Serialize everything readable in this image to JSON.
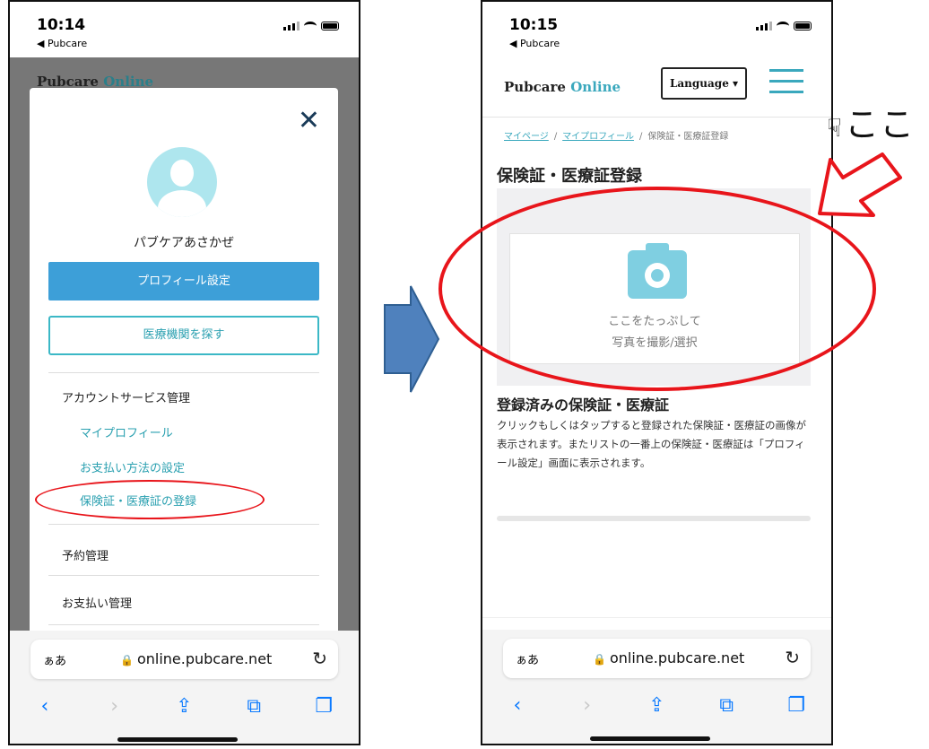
{
  "left_phone": {
    "status": {
      "time": "10:14",
      "back_label": "◀ Pubcare"
    },
    "background_logo": {
      "brand": "Pubcare",
      "suffix": "Online"
    },
    "modal": {
      "close_glyph": "✕",
      "user_name": "パブケアあさかぜ",
      "profile_button": "プロフィール設定",
      "search_button": "医療機関を探す",
      "sections": {
        "account_heading": "アカウントサービス管理",
        "items": [
          "マイプロフィール",
          "お支払い方法の設定",
          "保険証・医療証の登録"
        ],
        "reservation": "予約管理",
        "payment": "お支払い管理"
      }
    },
    "browser": {
      "aa": "ぁあ",
      "url": "online.pubcare.net"
    }
  },
  "right_phone": {
    "status": {
      "time": "10:15",
      "back_label": "◀ Pubcare"
    },
    "header": {
      "brand": "Pubcare",
      "suffix": "Online",
      "language_button": "Language ▾"
    },
    "breadcrumb": {
      "mypage": "マイページ",
      "sep": "/",
      "myprofile": "マイプロフィール",
      "current": "保険証・医療証登録"
    },
    "page_title": "保険証・医療証登録",
    "upload": {
      "line1": "ここをたっぷして",
      "line2": "写真を撮影/選択"
    },
    "registered": {
      "title": "登録済みの保険証・医療証",
      "description": "クリックもしくはタップすると登録された保険証・医療証の画像が表示されます。またリストの一番上の保険証・医療証は「プロフィール設定」画面に表示されます。"
    },
    "browser": {
      "aa": "ぁあ",
      "url": "online.pubcare.net"
    }
  },
  "annotation": {
    "note": "ここ",
    "hand_icon": "pointing-hand-icon",
    "highlight_color": "#e8151b",
    "arrow_color": "#4f81bd"
  }
}
